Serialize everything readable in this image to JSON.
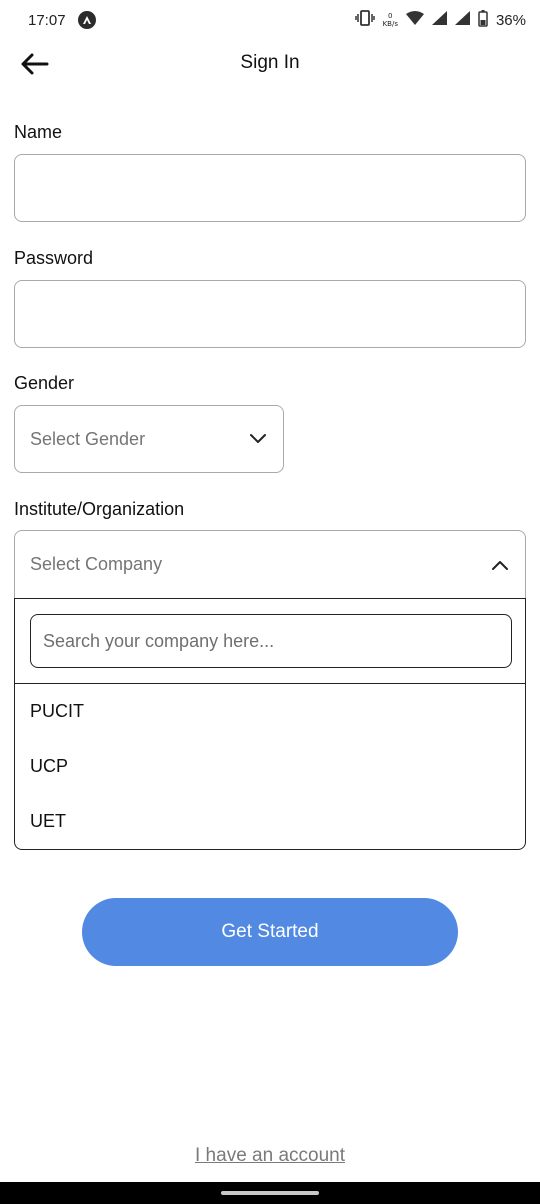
{
  "status_bar": {
    "time": "17:07",
    "net_speed_value": "0",
    "net_speed_unit": "KB/s",
    "battery": "36%"
  },
  "header": {
    "title": "Sign In"
  },
  "form": {
    "name_label": "Name",
    "name_value": "",
    "password_label": "Password",
    "password_value": "",
    "gender_label": "Gender",
    "gender_placeholder": "Select Gender",
    "company_label": "Institute/Organization",
    "company_placeholder": "Select Company",
    "company_search_placeholder": "Search your company here...",
    "company_options": [
      "PUCIT",
      "UCP",
      "UET"
    ]
  },
  "actions": {
    "get_started_label": "Get Started",
    "account_link": "I have an account"
  },
  "colors": {
    "primary_button": "#5189e3",
    "link": "#7a7a7a"
  }
}
